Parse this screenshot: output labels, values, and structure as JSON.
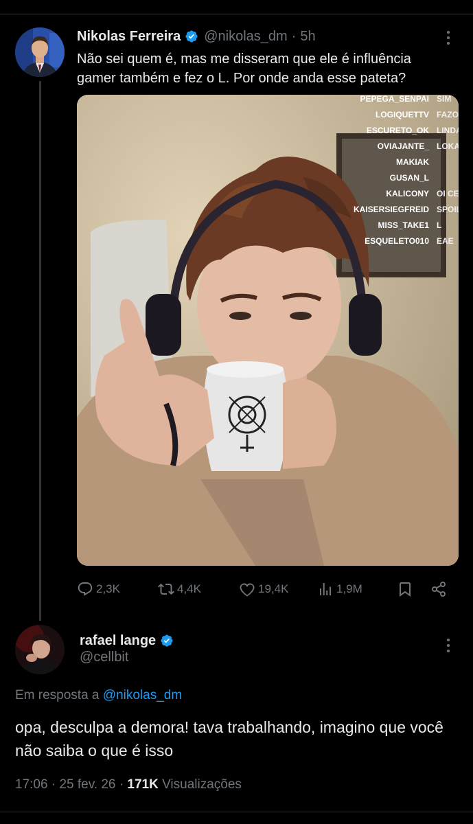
{
  "tweet": {
    "author_name": "Nikolas Ferreira",
    "handle": "@nikolas_dm",
    "separator": "·",
    "time": "5h",
    "text": "Não sei quem é, mas me disseram que ele é influência gamer também e fez o L. Por onde anda esse pateta?",
    "media": {
      "chat": [
        {
          "user": "PEPEGA_SENPAI",
          "msg": "SIM"
        },
        {
          "user": "LOGIQUETTV",
          "msg": "FAZO"
        },
        {
          "user": "ESCURETO_OK",
          "msg": "LINDA"
        },
        {
          "user": "OVIAJANTE_",
          "msg": "LOKA"
        },
        {
          "user": "MAKIAK",
          "msg": ""
        },
        {
          "user": "GUSAN_L",
          "msg": ""
        },
        {
          "user": "KALICONY",
          "msg": "OI CE"
        },
        {
          "user": "KAISERSIEGFREID",
          "msg": "SPOIL"
        },
        {
          "user": "MISS_TAKE1",
          "msg": "L"
        },
        {
          "user": "ESQUELETO010",
          "msg": "EAE"
        }
      ]
    },
    "stats": {
      "replies": "2,3K",
      "retweets": "4,4K",
      "likes": "19,4K",
      "views": "1,9M"
    }
  },
  "reply": {
    "author_name": "rafael lange",
    "handle": "@cellbit",
    "reply_prefix": "Em resposta a",
    "reply_to": "@nikolas_dm",
    "text": "opa, desculpa a demora! tava trabalhando, imagino que você não saiba o que é isso",
    "time": "17:06",
    "date": "25 fev. 26",
    "views_count": "171K",
    "views_label": "Visualizações"
  },
  "colors": {
    "background": "#000000",
    "text": "#e7e9ea",
    "secondary": "#71767b",
    "accent": "#1d9bf0",
    "divider": "#2f3336"
  },
  "icons": [
    "verified-badge-icon",
    "more-icon",
    "reply-icon",
    "retweet-icon",
    "like-icon",
    "views-icon",
    "bookmark-icon",
    "share-icon"
  ]
}
